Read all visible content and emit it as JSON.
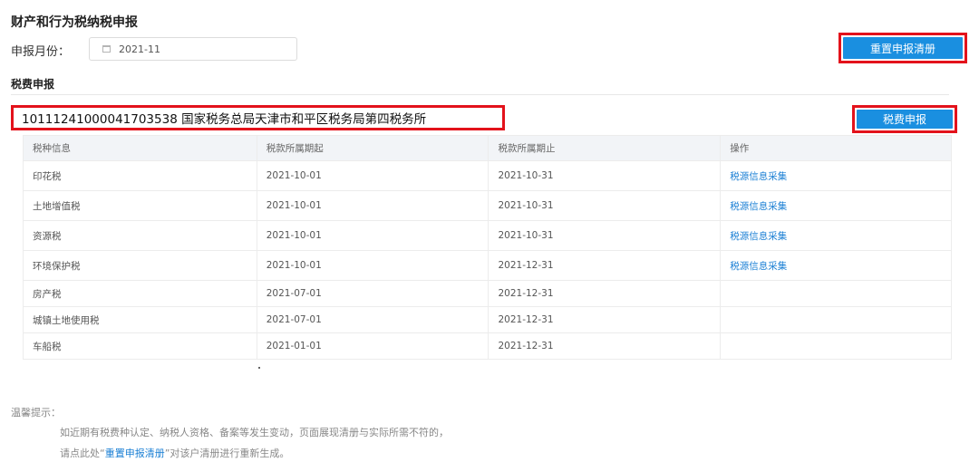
{
  "page": {
    "title": "财产和行为税纳税申报"
  },
  "month": {
    "label": "申报月份：",
    "value": "2021-11"
  },
  "reset_button": "重置申报清册",
  "section_title": "税费申报",
  "taxpayer": {
    "text": "10111241000041703538 国家税务总局天津市和平区税务局第四税务所"
  },
  "declare_button": "税费申报",
  "table": {
    "headers": [
      "税种信息",
      "税款所属期起",
      "税款所属期止",
      "操作"
    ],
    "rows": [
      {
        "tax": "印花税",
        "start": "2021-10-01",
        "end": "2021-10-31",
        "action": "税源信息采集"
      },
      {
        "tax": "土地增值税",
        "start": "2021-10-01",
        "end": "2021-10-31",
        "action": "税源信息采集"
      },
      {
        "tax": "资源税",
        "start": "2021-10-01",
        "end": "2021-10-31",
        "action": "税源信息采集"
      },
      {
        "tax": "环境保护税",
        "start": "2021-10-01",
        "end": "2021-12-31",
        "action": "税源信息采集"
      },
      {
        "tax": "房产税",
        "start": "2021-07-01",
        "end": "2021-12-31",
        "action": ""
      },
      {
        "tax": "城镇土地使用税",
        "start": "2021-07-01",
        "end": "2021-12-31",
        "action": ""
      },
      {
        "tax": "车船税",
        "start": "2021-01-01",
        "end": "2021-12-31",
        "action": ""
      }
    ]
  },
  "tips": {
    "title": "温馨提示：",
    "line1": "如近期有税费种认定、纳税人资格、备案等发生变动，页面展现清册与实际所需不符的，",
    "line2_prefix": "请点此处“",
    "line2_link": "重置申报清册",
    "line2_suffix": "”对该户清册进行重新生成。"
  },
  "colors": {
    "primary": "#1a8fe0",
    "highlight_border": "#e3121b",
    "link": "#1a7fd4"
  }
}
